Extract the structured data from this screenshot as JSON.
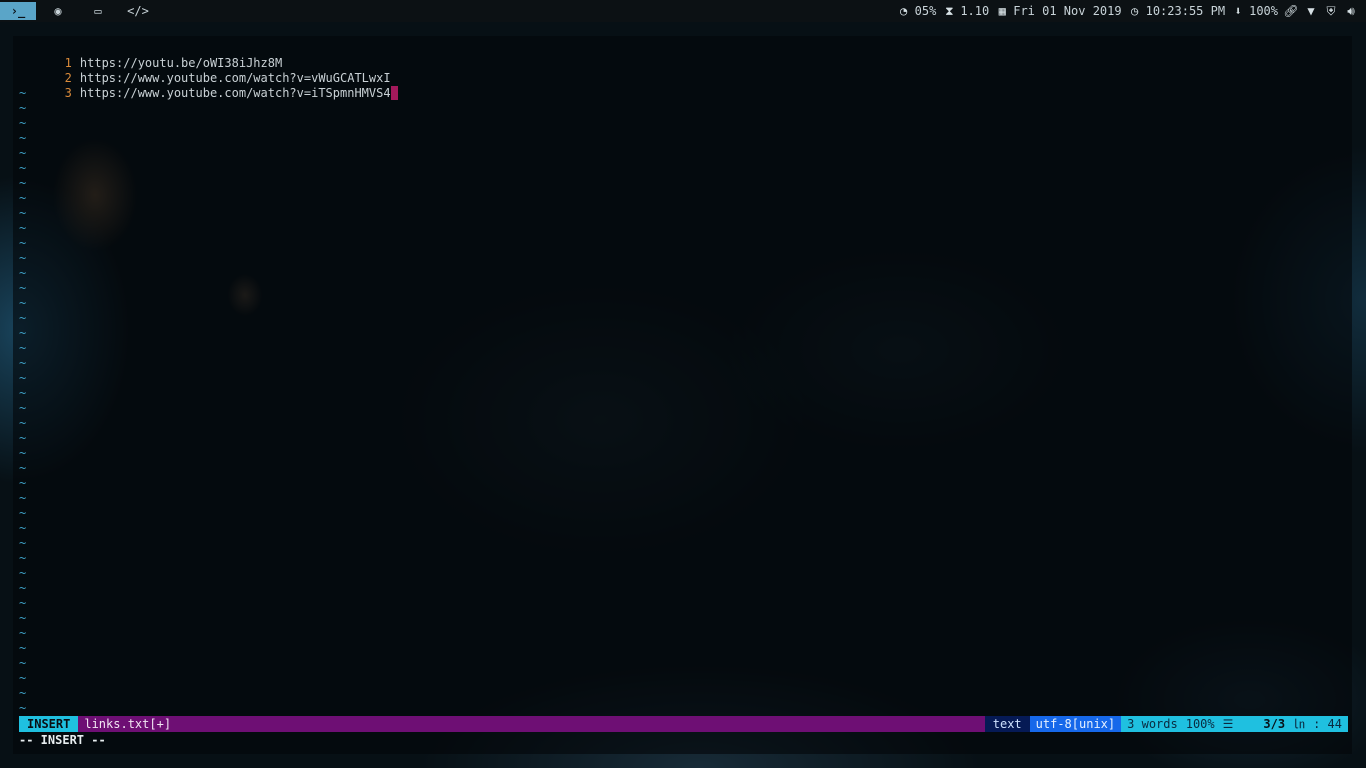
{
  "topbar": {
    "workspaces": [
      {
        "label": "›_",
        "icon": "terminal-icon"
      },
      {
        "label": "◉",
        "icon": "firefox-icon"
      },
      {
        "label": "▭",
        "icon": "laptop-icon"
      },
      {
        "label": "</>",
        "icon": "code-icon"
      }
    ],
    "cpu": "05%",
    "load": "1.10",
    "date": "Fri 01 Nov 2019",
    "time": "10:23:55 PM",
    "volume": "100%",
    "icons": {
      "cpu": "gauge-icon",
      "load": "hourglass-icon",
      "date": "calendar-icon",
      "time": "clock-icon",
      "volume": "arrow-down-circle-icon",
      "link": "link-icon",
      "wifi": "wifi-icon",
      "shield": "shield-icon",
      "speaker": "speaker-icon"
    },
    "colors": {
      "active_workspace": "#5aa5c8"
    }
  },
  "editor": {
    "lines": [
      {
        "num": "1",
        "text": "https://youtu.be/oWI38iJhz8M"
      },
      {
        "num": "2",
        "text": "https://www.youtube.com/watch?v=vWuGCATLwxI"
      },
      {
        "num": "3",
        "text": "https://www.youtube.com/watch?v=iTSpmnHMVS4"
      }
    ],
    "tilde": "~"
  },
  "statusline": {
    "mode": "INSERT",
    "filename": "links.txt[+]",
    "filetype": "text",
    "encoding": "utf-8[unix]",
    "words": "3 words",
    "percent": "100%",
    "percent_icon": "☰",
    "position": "3/3",
    "ln_icon": "㏑",
    "column": ": 44",
    "colors": {
      "mode": "#1fc0e0",
      "bar": "#6e0f74",
      "filetype": "#061a55",
      "encoding": "#1668ea"
    }
  },
  "cmdline": "-- INSERT --"
}
